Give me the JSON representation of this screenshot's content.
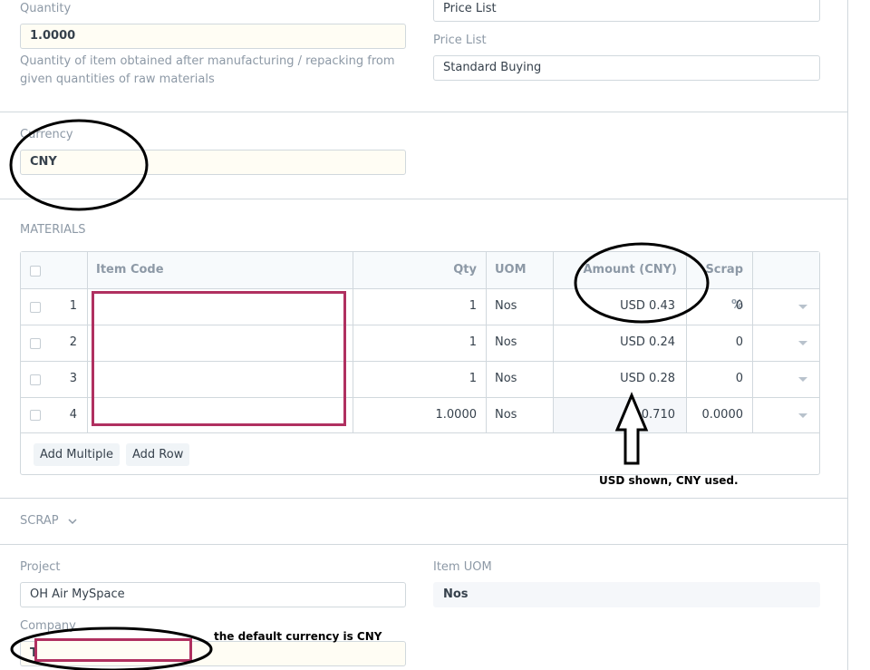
{
  "quantity": {
    "label": "Quantity",
    "value": "1.0000",
    "help_line1": "Quantity of item obtained after manufacturing / repacking from",
    "help_line2": "given quantities of raw materials"
  },
  "price_list_top": {
    "value": "Price List"
  },
  "price_list": {
    "label": "Price List",
    "value": "Standard Buying"
  },
  "currency": {
    "label": "Currency",
    "value": "CNY"
  },
  "materials": {
    "section_title": "MATERIALS",
    "columns": {
      "item_code": "Item Code",
      "qty": "Qty",
      "uom": "UOM",
      "amount": "Amount (CNY)",
      "scrap": "Scrap %"
    },
    "rows": [
      {
        "idx": "1",
        "qty": "1",
        "uom": "Nos",
        "amount": "USD 0.43",
        "scrap": "0"
      },
      {
        "idx": "2",
        "qty": "1",
        "uom": "Nos",
        "amount": "USD 0.24",
        "scrap": "0"
      },
      {
        "idx": "3",
        "qty": "1",
        "uom": "Nos",
        "amount": "USD 0.28",
        "scrap": "0"
      },
      {
        "idx": "4",
        "qty": "1.0000",
        "uom": "Nos",
        "amount": "0.710",
        "scrap": "0.0000"
      }
    ],
    "add_multiple": "Add Multiple",
    "add_row": "Add Row"
  },
  "scrap": {
    "section_title": "SCRAP"
  },
  "project": {
    "label": "Project",
    "value": "OH Air MySpace"
  },
  "item_uom": {
    "label": "Item UOM",
    "value": "Nos"
  },
  "company": {
    "label": "Company",
    "value": "T"
  },
  "annotations": {
    "usd_note": "USD shown, CNY used.",
    "default_currency_note": "the default currency is CNY",
    "ink_color": "#000000",
    "redact_color": "#b03060"
  }
}
